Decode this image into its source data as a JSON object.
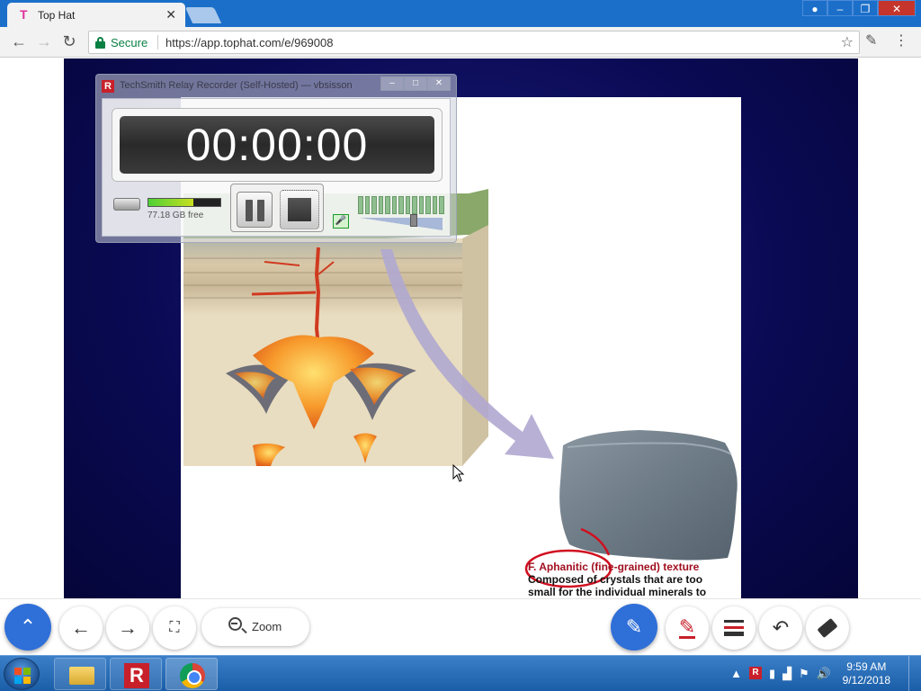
{
  "browser": {
    "tab_title": "Top Hat",
    "tab_favicon": "tophat-icon",
    "secure_label": "Secure",
    "url": "https://app.tophat.com/e/969008"
  },
  "recorder": {
    "title": "TechSmith Relay Recorder (Self-Hosted) — vbsisson",
    "logo": "R",
    "timer": "00:00:00",
    "disk_free": "77.18 GB free",
    "disk_fill_fraction": 0.62
  },
  "slide": {
    "caption_title_a": "F. Aphanitic (",
    "caption_title_b": "fine-grained) texture",
    "caption_line1": "Composed of crystals that are too",
    "caption_line2": "small for the individual minerals to",
    "colors": {
      "background": "#0a0a55",
      "caption_red": "#a01020",
      "annotation": "#d01020"
    }
  },
  "controls": {
    "zoom_label": "Zoom",
    "accent": "#2f6fd8"
  },
  "taskbar": {
    "time": "9:59 AM",
    "date": "9/12/2018",
    "relay_label": "R"
  }
}
